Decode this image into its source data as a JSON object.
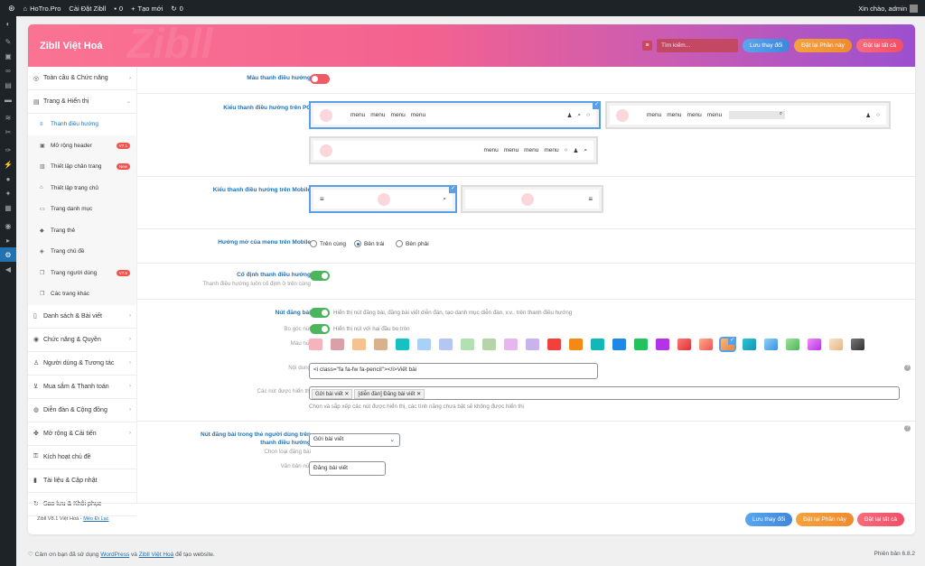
{
  "adminbar": {
    "site": "HoTro.Pro",
    "settings": "Cài Đặt Zibll",
    "comments": "0",
    "new": "Tạo mới",
    "updates": "0",
    "greeting": "Xin chào, admin"
  },
  "panel": {
    "title": "Zibll Việt Hoá",
    "watermark": "Zibll",
    "search_placeholder": "Tìm kiếm...",
    "save": "Lưu thay đổi",
    "reset_section": "Đặt lại Phần này",
    "reset_all": "Đặt lại tất cả"
  },
  "nav": {
    "g1": "Toàn cầu & Chức năng",
    "g2": "Trang & Hiển thị",
    "s1": "Thanh điều hướng",
    "s2": "Mở rộng header",
    "s2_badge": "V7.1",
    "s3": "Thiết lập chân trang",
    "s3_badge": "New",
    "s4": "Thiết lập trang chủ",
    "s5": "Trang danh mục",
    "s6": "Trang thẻ",
    "s7": "Trang chủ đề",
    "s8": "Trang người dùng",
    "s8_badge": "V7.5",
    "s9": "Các trang khác",
    "g3": "Danh sách & Bài viết",
    "g4": "Chức năng & Quyền",
    "g5": "Người dùng & Tương tác",
    "g6": "Mua sắm & Thanh toán",
    "g7": "Diễn đàn & Cộng đồng",
    "g8": "Mở rộng & Cải tiến",
    "g9": "Kích hoạt chủ đề",
    "g10": "Tài liệu & Cập nhật",
    "g11": "Sao lưu & Khôi phục"
  },
  "fields": {
    "menu_color": "Màu thanh điều hướng",
    "pc_layout": "Kiểu thanh điều hướng trên PC",
    "menu_word": "menu",
    "mobile_layout": "Kiểu thanh điều hướng trên Mobile",
    "mobile_dir": "Hướng mở của menu trên Mobile",
    "dir_options": [
      "Trên cùng",
      "Bên trái",
      "Bên phải"
    ],
    "dir_selected": "Bên trái",
    "fixed": "Cố định thanh điều hướng",
    "fixed_desc": "Thanh điều hướng luôn cố định ở trên cùng",
    "post_btn": "Nút đăng bài",
    "post_btn_desc": "Hiển thị nút đăng bài, đăng bài viết diễn đàn, tạo danh mục diễn đàn, v.v., trên thanh điều hướng",
    "round": "Bo góc nút",
    "round_desc": "Hiển thị nút với hai đầu bo tròn",
    "btn_color": "Màu nút",
    "content": "Nội dung",
    "content_value": "<i class=\"fa fa-fw fa-pencil\"></i>Viết bài",
    "shown_btns": "Các nút được hiển thị",
    "tags": [
      "Gửi bài viết",
      "[diễn đàn] Đăng bài viết"
    ],
    "shown_desc": "Chọn và sắp xếp các nút được hiển thị, các tính năng chưa bật sẽ không được hiển thị",
    "user_btn": "Nút đăng bài trong thẻ người dùng trên thanh điều hướng",
    "user_btn_sub": "Chọn loại đăng bài",
    "user_btn_value": "Gửi bài viết",
    "btn_text": "Văn bản nút",
    "btn_text_value": "Đăng bài viết"
  },
  "swatches": [
    "#f5b3bb",
    "#d9a0a7",
    "#f6c28f",
    "#d8b28d",
    "#15c1c3",
    "#a9d0f6",
    "#b4c7f3",
    "#b2e0b0",
    "#b7d3a8",
    "#e5b6f0",
    "#c8b3ef",
    "#f2413d",
    "#f28a15",
    "#14b7b7",
    "#1e88e5",
    "#22c35d",
    "#b433e6",
    "linear-gradient(135deg,#f77,#d33)",
    "linear-gradient(135deg,#fa8,#e55)",
    "linear-gradient(135deg,#f6b67a,#e3874a)",
    "linear-gradient(135deg,#2cc5d1,#1793b8)",
    "linear-gradient(135deg,#8bd3f7,#3b8fe3)",
    "linear-gradient(135deg,#9ee39a,#4cb55b)",
    "linear-gradient(135deg,#f08ef5,#b433e6)",
    "linear-gradient(135deg,#f8e2c8,#e6b58a)",
    "linear-gradient(135deg,#777,#333)"
  ],
  "footer": {
    "ver_text": "Zibll V8.1 Việt Hoá - ",
    "author": "Mèo Đi Lạc",
    "wp_pre": "Cảm ơn bạn đã sử dụng ",
    "wp_link": "WordPress",
    "wp_mid": " và ",
    "zibll_link": "Zibll Việt Hoá",
    "wp_post": " để tạo website.",
    "version": "Phiên bản 6.8.2"
  }
}
